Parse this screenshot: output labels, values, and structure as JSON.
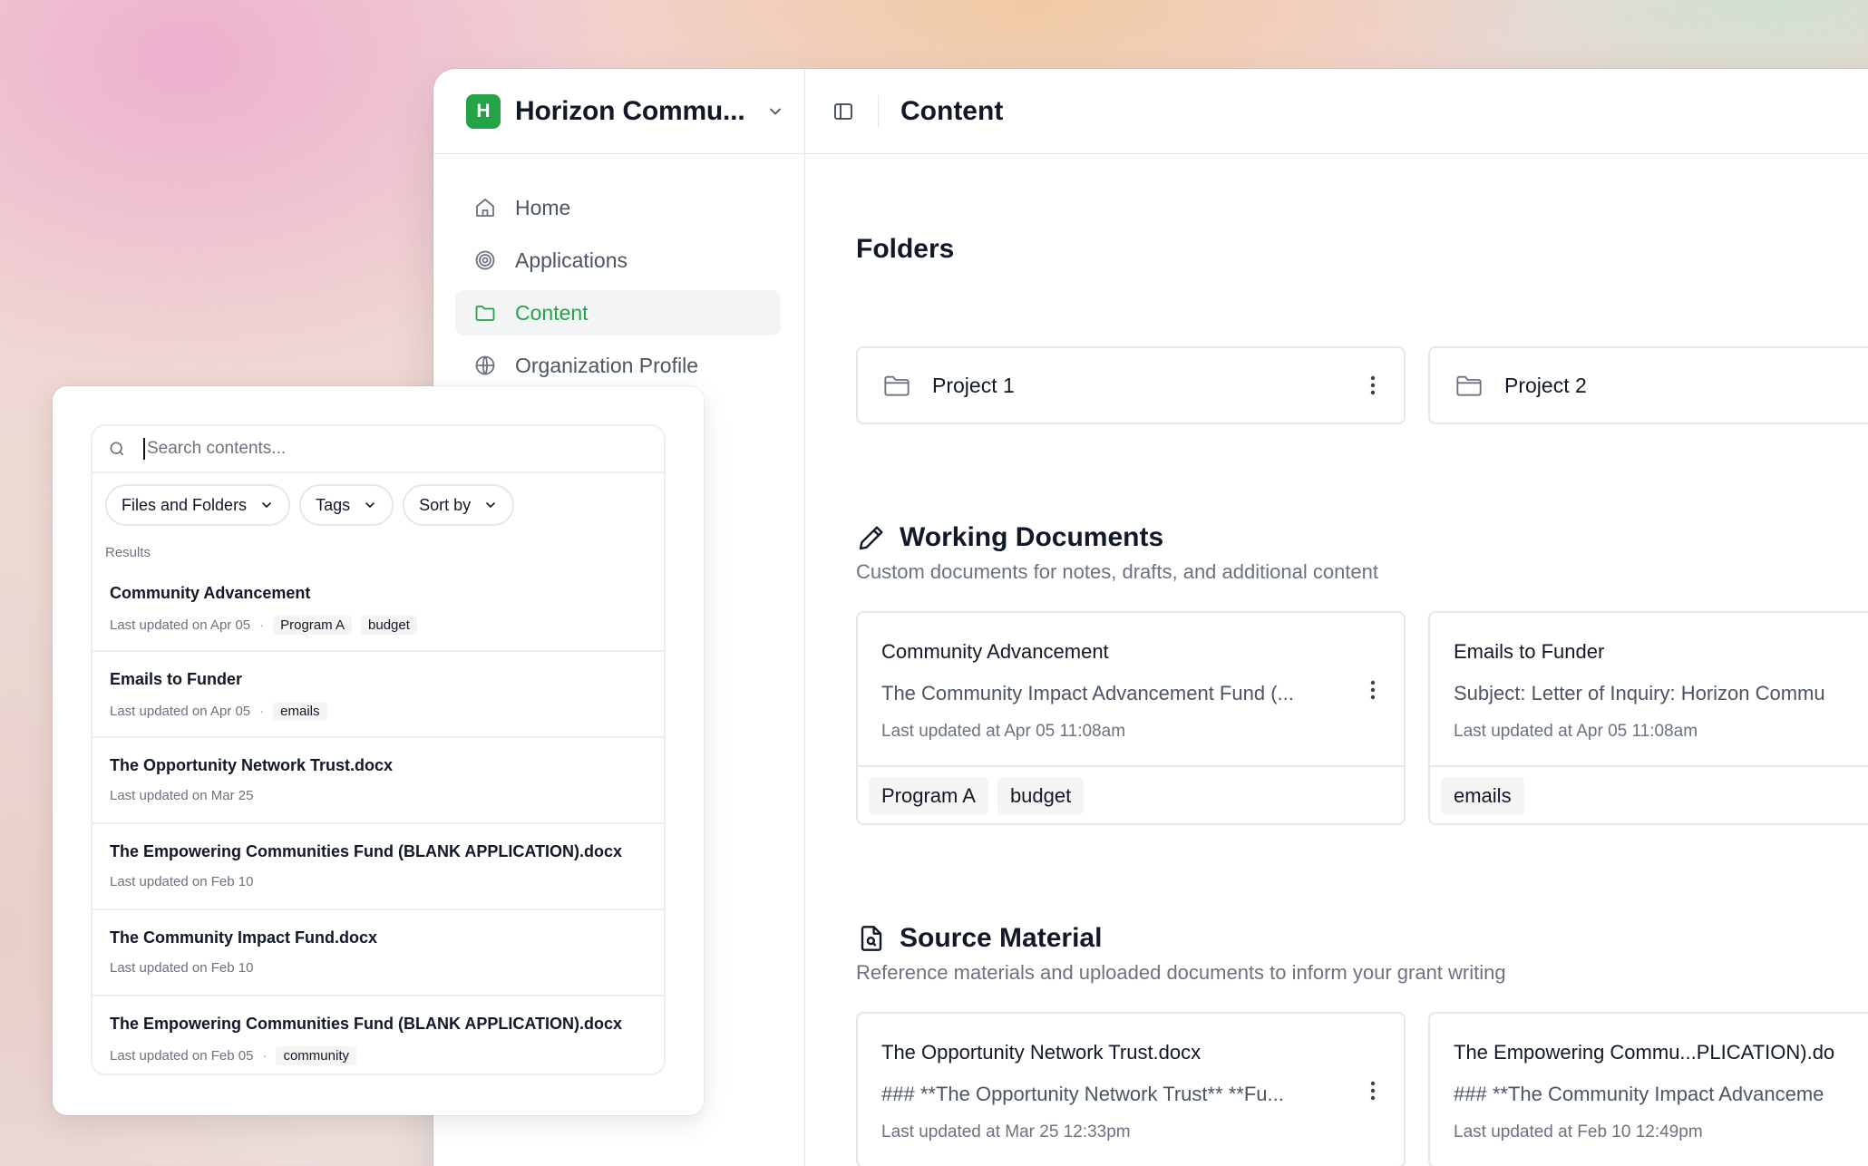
{
  "org": {
    "initial": "H",
    "name": "Horizon Commu..."
  },
  "nav": [
    {
      "label": "Home",
      "icon": "home-icon"
    },
    {
      "label": "Applications",
      "icon": "target-icon"
    },
    {
      "label": "Content",
      "icon": "folder-icon",
      "active": true
    },
    {
      "label": "Organization Profile",
      "icon": "globe-icon"
    }
  ],
  "topbar": {
    "title": "Content"
  },
  "folders": {
    "title": "Folders",
    "items": [
      {
        "name": "Project 1"
      },
      {
        "name": "Project 2"
      }
    ]
  },
  "working": {
    "title": "Working Documents",
    "description": "Custom documents for notes, drafts, and additional content",
    "items": [
      {
        "title": "Community Advancement",
        "excerpt": "The Community Impact Advancement Fund (...",
        "date": "Last updated at Apr 05 11:08am",
        "tags": [
          "Program A",
          "budget"
        ]
      },
      {
        "title": "Emails to Funder",
        "excerpt": "Subject: Letter of Inquiry: Horizon Commu",
        "date": "Last updated at Apr 05 11:08am",
        "tags": [
          "emails"
        ]
      }
    ]
  },
  "source": {
    "title": "Source Material",
    "description": "Reference materials and uploaded documents to inform your grant writing",
    "items": [
      {
        "title": "The Opportunity Network Trust.docx",
        "excerpt": "### **The Opportunity Network Trust** **Fu...",
        "date": "Last updated at Mar 25 12:33pm"
      },
      {
        "title": "The Empowering Commu...PLICATION).do",
        "excerpt": "### **The Community Impact Advanceme",
        "date": "Last updated at Feb 10 12:49pm"
      }
    ]
  },
  "search": {
    "placeholder": "Search contents...",
    "filters": [
      "Files and Folders",
      "Tags",
      "Sort by"
    ],
    "results_label": "Results",
    "results": [
      {
        "title": "Community Advancement",
        "date": "Last updated on Apr 05",
        "tags": [
          "Program A",
          "budget"
        ]
      },
      {
        "title": "Emails to Funder",
        "date": "Last updated on Apr 05",
        "tags": [
          "emails"
        ]
      },
      {
        "title": "The Opportunity Network Trust.docx",
        "date": "Last updated on Mar 25",
        "tags": []
      },
      {
        "title": "The Empowering Communities Fund (BLANK APPLICATION).docx",
        "date": "Last updated on Feb 10",
        "tags": []
      },
      {
        "title": "The Community Impact Fund.docx",
        "date": "Last updated on Feb 10",
        "tags": []
      },
      {
        "title": "The Empowering Communities Fund (BLANK APPLICATION).docx",
        "date": "Last updated on Feb 05",
        "tags": [
          "community"
        ]
      }
    ]
  },
  "colors": {
    "accent": "#22a447",
    "border": "#e5e7eb",
    "muted": "#6b7280"
  }
}
